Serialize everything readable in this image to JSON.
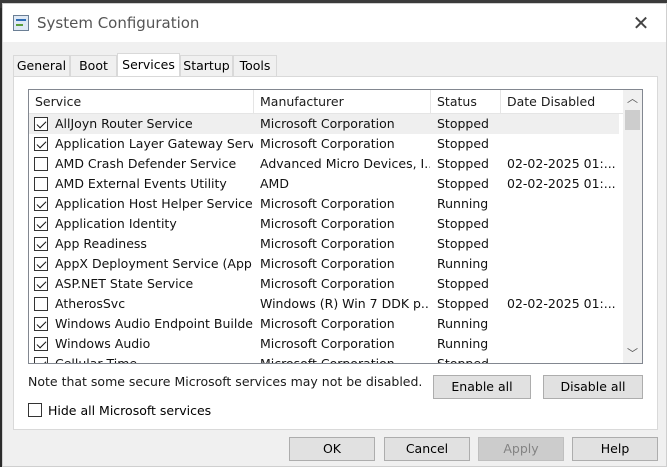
{
  "window": {
    "title": "System Configuration"
  },
  "tabs": [
    {
      "label": "General"
    },
    {
      "label": "Boot"
    },
    {
      "label": "Services"
    },
    {
      "label": "Startup"
    },
    {
      "label": "Tools"
    }
  ],
  "columns": {
    "service": "Service",
    "manufacturer": "Manufacturer",
    "status": "Status",
    "date": "Date Disabled"
  },
  "rows": [
    {
      "service": "AllJoyn Router Service",
      "manufacturer": "Microsoft Corporation",
      "status": "Stopped",
      "date": "",
      "checked": true
    },
    {
      "service": "Application Layer Gateway Service",
      "manufacturer": "Microsoft Corporation",
      "status": "Stopped",
      "date": "",
      "checked": true
    },
    {
      "service": "AMD Crash Defender Service",
      "manufacturer": "Advanced Micro Devices, I...",
      "status": "Stopped",
      "date": "02-02-2025 01:...",
      "checked": false
    },
    {
      "service": "AMD External Events Utility",
      "manufacturer": "AMD",
      "status": "Stopped",
      "date": "02-02-2025 01:...",
      "checked": false
    },
    {
      "service": "Application Host Helper Service",
      "manufacturer": "Microsoft Corporation",
      "status": "Running",
      "date": "",
      "checked": true
    },
    {
      "service": "Application Identity",
      "manufacturer": "Microsoft Corporation",
      "status": "Stopped",
      "date": "",
      "checked": true
    },
    {
      "service": "App Readiness",
      "manufacturer": "Microsoft Corporation",
      "status": "Stopped",
      "date": "",
      "checked": true
    },
    {
      "service": "AppX Deployment Service (App...",
      "manufacturer": "Microsoft Corporation",
      "status": "Running",
      "date": "",
      "checked": true
    },
    {
      "service": "ASP.NET State Service",
      "manufacturer": "Microsoft Corporation",
      "status": "Stopped",
      "date": "",
      "checked": true
    },
    {
      "service": "AtherosSvc",
      "manufacturer": "Windows (R) Win 7 DDK p...",
      "status": "Stopped",
      "date": "02-02-2025 01:...",
      "checked": false
    },
    {
      "service": "Windows Audio Endpoint Builder",
      "manufacturer": "Microsoft Corporation",
      "status": "Running",
      "date": "",
      "checked": true
    },
    {
      "service": "Windows Audio",
      "manufacturer": "Microsoft Corporation",
      "status": "Running",
      "date": "",
      "checked": true
    },
    {
      "service": "Cellular Time",
      "manufacturer": "Microsoft Corporation",
      "status": "Stopped",
      "date": "",
      "checked": true
    }
  ],
  "note": "Note that some secure Microsoft services may not be disabled.",
  "buttons": {
    "enable_all": "Enable all",
    "disable_all": "Disable all",
    "ok": "OK",
    "cancel": "Cancel",
    "apply": "Apply",
    "help": "Help"
  },
  "hide_ms": {
    "label": "Hide all Microsoft services",
    "checked": false
  },
  "icons": {
    "close": "close-icon",
    "app": "system-config-icon",
    "scroll_up": "chevron-up-icon",
    "scroll_down": "chevron-down-icon"
  }
}
